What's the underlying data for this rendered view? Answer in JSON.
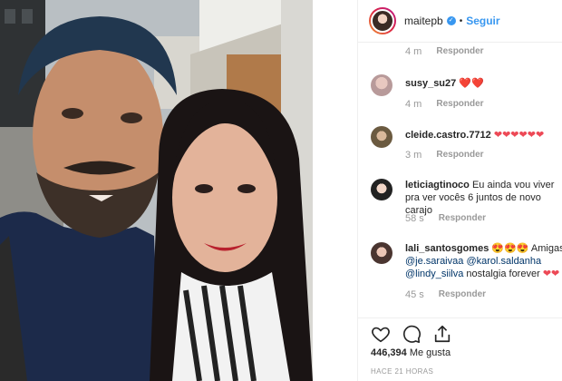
{
  "post": {
    "username": "maitepb",
    "separator": "•",
    "follow_label": "Seguir",
    "likes_count": "446,394",
    "likes_suffix": "Me gusta",
    "posted_ago": "HACE 21 HORAS"
  },
  "reply_label": "Responder",
  "comments": [
    {
      "time": "4 m"
    },
    {
      "user": "susy_su27",
      "text": "❤️❤️",
      "time": "4 m"
    },
    {
      "user": "cleide.castro.7712",
      "text": "❤❤❤❤❤❤",
      "time": "3 m"
    },
    {
      "user": "leticiagtinoco",
      "text": "Eu ainda vou viver pra ver vocês 6 juntos de novo carajo",
      "time": "58 s"
    },
    {
      "user": "lali_santosgomes",
      "text": "😍😍😍 Amigas",
      "mentions": [
        "@je.saraivaa",
        "@karol.saldanha",
        "@lindy_siilva"
      ],
      "text2": "nostalgia forever",
      "text3": "❤❤",
      "time": "45 s"
    }
  ],
  "colors": {
    "accent": "#3897f0",
    "heart": "#ed4956",
    "muted": "#999999"
  },
  "icons": [
    "heart-icon",
    "comment-icon",
    "share-icon",
    "verified-badge-icon"
  ]
}
